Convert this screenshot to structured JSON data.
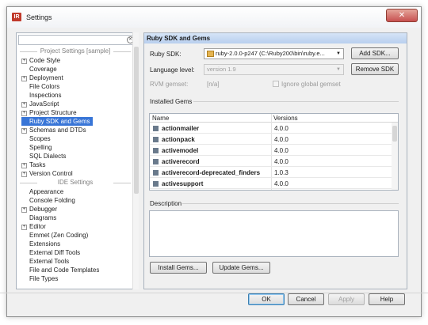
{
  "window": {
    "title": "Settings",
    "app_icon": "IR"
  },
  "search": {
    "value": "",
    "placeholder": ""
  },
  "left": {
    "project_header": "Project Settings [sample]",
    "project_items": [
      {
        "label": "Code Style",
        "expandable": true
      },
      {
        "label": "Coverage",
        "expandable": false
      },
      {
        "label": "Deployment",
        "expandable": true
      },
      {
        "label": "File Colors",
        "expandable": false
      },
      {
        "label": "Inspections",
        "expandable": false
      },
      {
        "label": "JavaScript",
        "expandable": true
      },
      {
        "label": "Project Structure",
        "expandable": true
      },
      {
        "label": "Ruby SDK and Gems",
        "expandable": false,
        "selected": true
      },
      {
        "label": "Schemas and DTDs",
        "expandable": true
      },
      {
        "label": "Scopes",
        "expandable": false
      },
      {
        "label": "Spelling",
        "expandable": false
      },
      {
        "label": "SQL Dialects",
        "expandable": false
      },
      {
        "label": "Tasks",
        "expandable": true
      },
      {
        "label": "Version Control",
        "expandable": true
      }
    ],
    "ide_header": "IDE Settings",
    "ide_items": [
      {
        "label": "Appearance",
        "expandable": false
      },
      {
        "label": "Console Folding",
        "expandable": false
      },
      {
        "label": "Debugger",
        "expandable": true
      },
      {
        "label": "Diagrams",
        "expandable": false
      },
      {
        "label": "Editor",
        "expandable": true
      },
      {
        "label": "Emmet (Zen Coding)",
        "expandable": false
      },
      {
        "label": "Extensions",
        "expandable": false
      },
      {
        "label": "External Diff Tools",
        "expandable": false
      },
      {
        "label": "External Tools",
        "expandable": false
      },
      {
        "label": "File and Code Templates",
        "expandable": false
      },
      {
        "label": "File Types",
        "expandable": false
      }
    ]
  },
  "right": {
    "header": "Ruby SDK and Gems",
    "sdk_label": "Ruby SDK:",
    "sdk_value": "ruby-2.0.0-p247 (C:\\Ruby200\\bin\\ruby.e...",
    "add_sdk": "Add SDK...",
    "language_label": "Language level:",
    "language_value": "version 1.9",
    "remove_sdk": "Remove SDK",
    "rvm_label": "RVM gemset:",
    "rvm_value": "[n/a]",
    "ignore_gemset": "Ignore global gemset",
    "installed_gems_label": "Installed Gems",
    "col_name": "Name",
    "col_versions": "Versions",
    "gems": [
      {
        "name": "actionmailer",
        "version": "4.0.0"
      },
      {
        "name": "actionpack",
        "version": "4.0.0"
      },
      {
        "name": "activemodel",
        "version": "4.0.0"
      },
      {
        "name": "activerecord",
        "version": "4.0.0"
      },
      {
        "name": "activerecord-deprecated_finders",
        "version": "1.0.3"
      },
      {
        "name": "activesupport",
        "version": "4.0.0"
      }
    ],
    "description_label": "Description",
    "install_gems": "Install Gems...",
    "update_gems": "Update Gems..."
  },
  "footer": {
    "ok": "OK",
    "cancel": "Cancel",
    "apply": "Apply",
    "help": "Help"
  }
}
